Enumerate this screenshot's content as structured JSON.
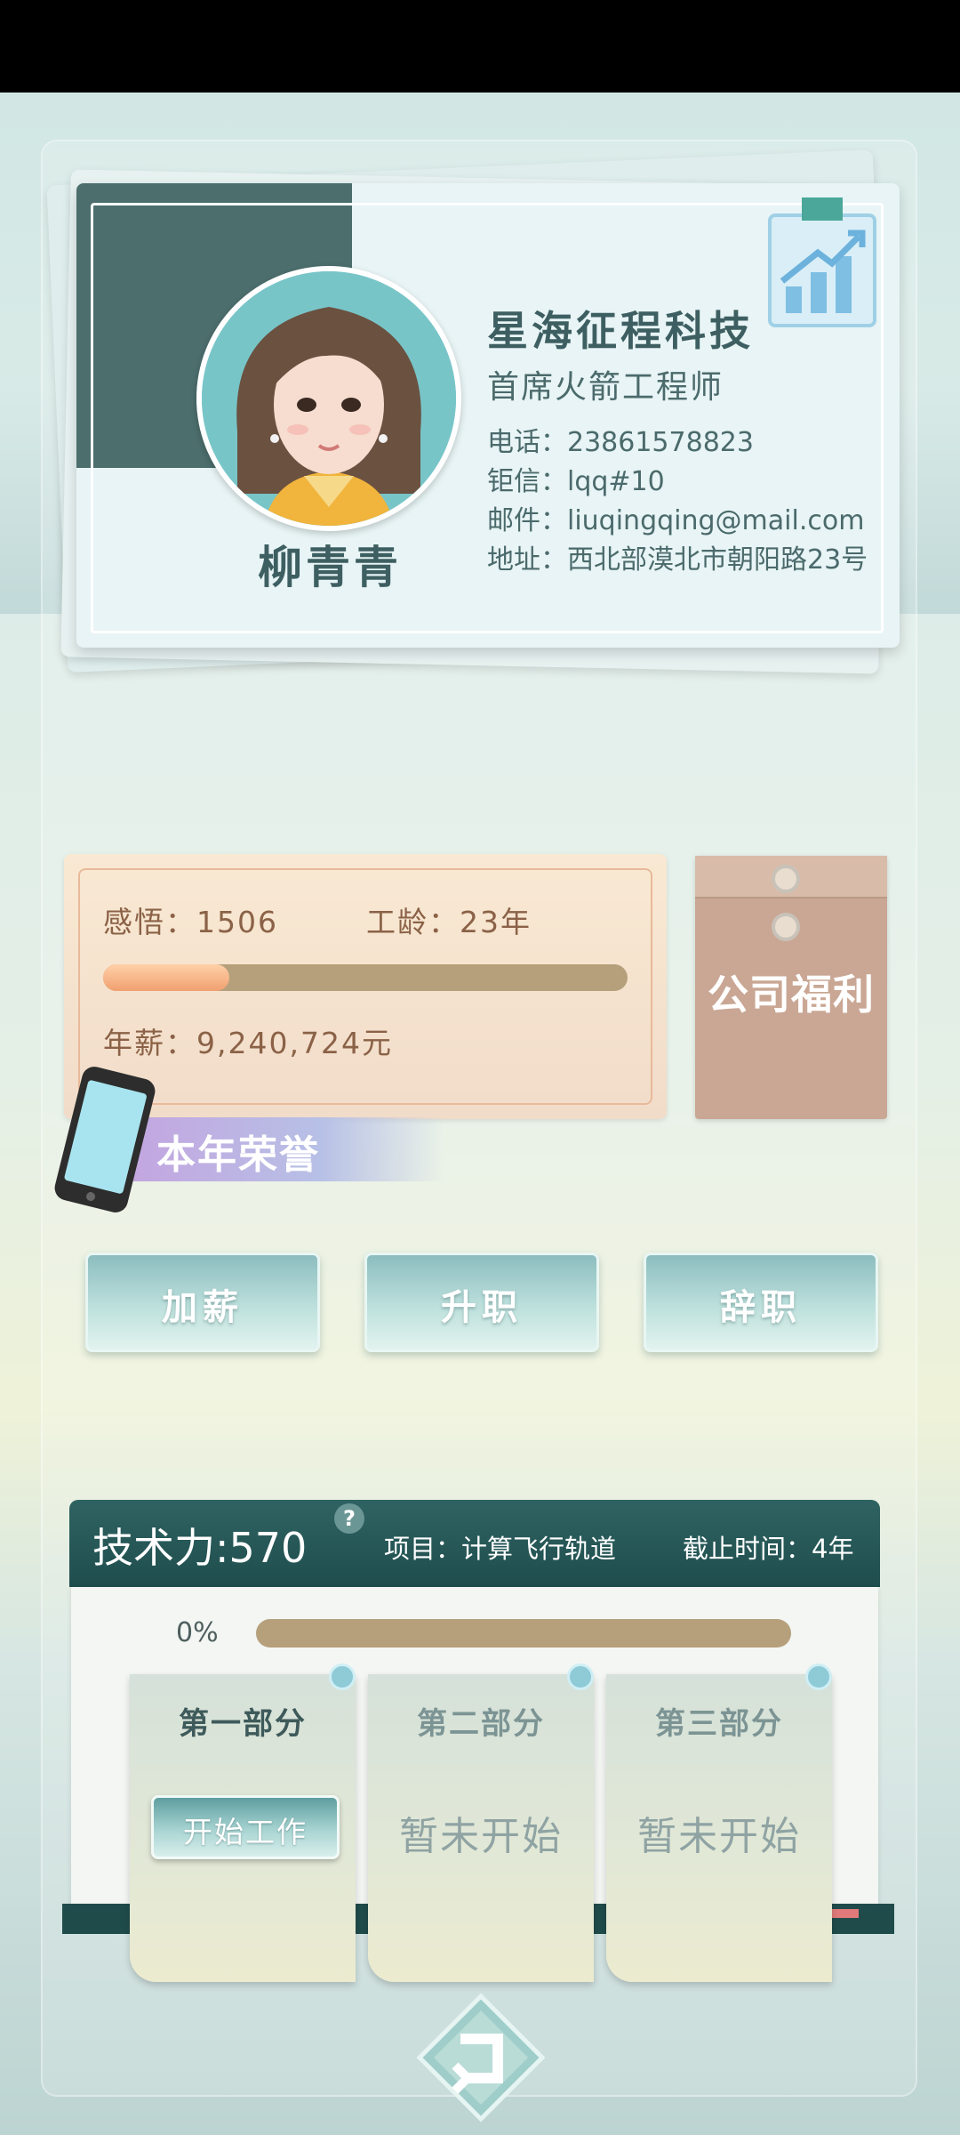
{
  "profile": {
    "name": "柳青青",
    "company": "星海征程科技",
    "title": "首席火箭工程师",
    "phone": "电话：23861578823",
    "qianxin": "钜信：lqq#10",
    "email": "邮件：liuqingqing@mail.com",
    "address": "地址：西北部漠北市朝阳路23号"
  },
  "stats": {
    "insight": "感悟：1506",
    "seniority": "工龄：23年",
    "salary": "年薪：9,240,724元",
    "progress_fraction": 0.24
  },
  "welfare_label": "公司福利",
  "honor_label": "本年荣誉",
  "actions": {
    "raise": "加薪",
    "promote": "升职",
    "resign": "辞职"
  },
  "tech": {
    "power": "技术力:570",
    "help": "?",
    "project": "项目：计算飞行轨道",
    "deadline": "截止时间：4年",
    "progress": "0%",
    "parts": [
      {
        "title": "第一部分",
        "button": "开始工作"
      },
      {
        "title": "第二部分",
        "status": "暂未开始"
      },
      {
        "title": "第三部分",
        "status": "暂未开始"
      }
    ]
  },
  "icons": {
    "back": "return-arrow-icon",
    "chart": "growth-chart-icon",
    "phone": "phone-icon"
  }
}
